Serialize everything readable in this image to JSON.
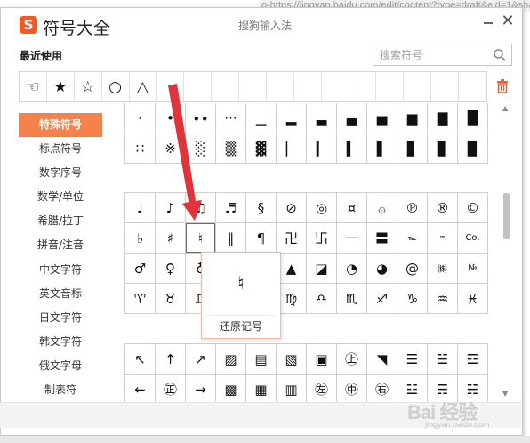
{
  "background": {
    "url_fragment": "o-https://jingyan.baidu.com/edit/content?type=draft&eid=1&sharFrom"
  },
  "window": {
    "logo": "S",
    "title": "符号大全",
    "subtitle": "搜狗输入法",
    "close": "✕"
  },
  "recent": {
    "label": "最近使用",
    "symbols": [
      "☜",
      "★",
      "☆",
      "○",
      "△",
      "",
      "",
      "",
      "",
      "",
      "",
      "",
      "",
      "",
      "",
      "",
      ""
    ]
  },
  "search": {
    "placeholder": "搜索符号"
  },
  "sidebar": {
    "items": [
      {
        "label": "特殊符号",
        "active": true
      },
      {
        "label": "标点符号"
      },
      {
        "label": "数字序号"
      },
      {
        "label": "数学/单位"
      },
      {
        "label": "希腊/拉丁"
      },
      {
        "label": "拼音/注音"
      },
      {
        "label": "中文字符"
      },
      {
        "label": "英文音标"
      },
      {
        "label": "日文字符"
      },
      {
        "label": "韩文字符"
      },
      {
        "label": "俄文字母"
      },
      {
        "label": "制表符"
      }
    ]
  },
  "grids": {
    "block1": [
      "·",
      "•",
      "∙∙",
      "···",
      "▁",
      "▂",
      "▃",
      "▄",
      "▅",
      "▆",
      "▇",
      "█",
      "∷",
      "※",
      "░",
      "▒",
      "▓",
      "▏",
      "▎",
      "▍",
      "▌",
      "▋",
      "▊",
      "▉"
    ],
    "block2": [
      "♩",
      "♪",
      "♫",
      "♬",
      "§",
      "⊘",
      "◎",
      "¤",
      "۞",
      "℗",
      "®",
      "©",
      "♭",
      "♯",
      "♮",
      "‖",
      "¶",
      "卍",
      "卐",
      "一",
      "〓",
      "℡",
      "™",
      "Co.",
      "♂",
      "♀",
      "♁",
      "⊕",
      "⊙",
      "▲",
      "◪",
      "◔",
      "◕",
      "@",
      "㈱",
      "№",
      "♈",
      "♉",
      "♊",
      "♋",
      "♌",
      "♍",
      "♎",
      "♏",
      "♐",
      "♑",
      "♒",
      "♓"
    ],
    "block3": [
      "↖",
      "↑",
      "↗",
      "▨",
      "▤",
      "▧",
      "▣",
      "㊤",
      "◥",
      "☰",
      "☱",
      "☲",
      "←",
      "㊣",
      "→",
      "▩",
      "▦",
      "▥",
      "㊧",
      "㊥",
      "㊨",
      "☳",
      "☴",
      "☵"
    ]
  },
  "tooltip": {
    "glyph": "♮",
    "name": "还原记号"
  },
  "watermark": {
    "brand": "Bai 经验",
    "url": "jingyan.baidu.com"
  }
}
